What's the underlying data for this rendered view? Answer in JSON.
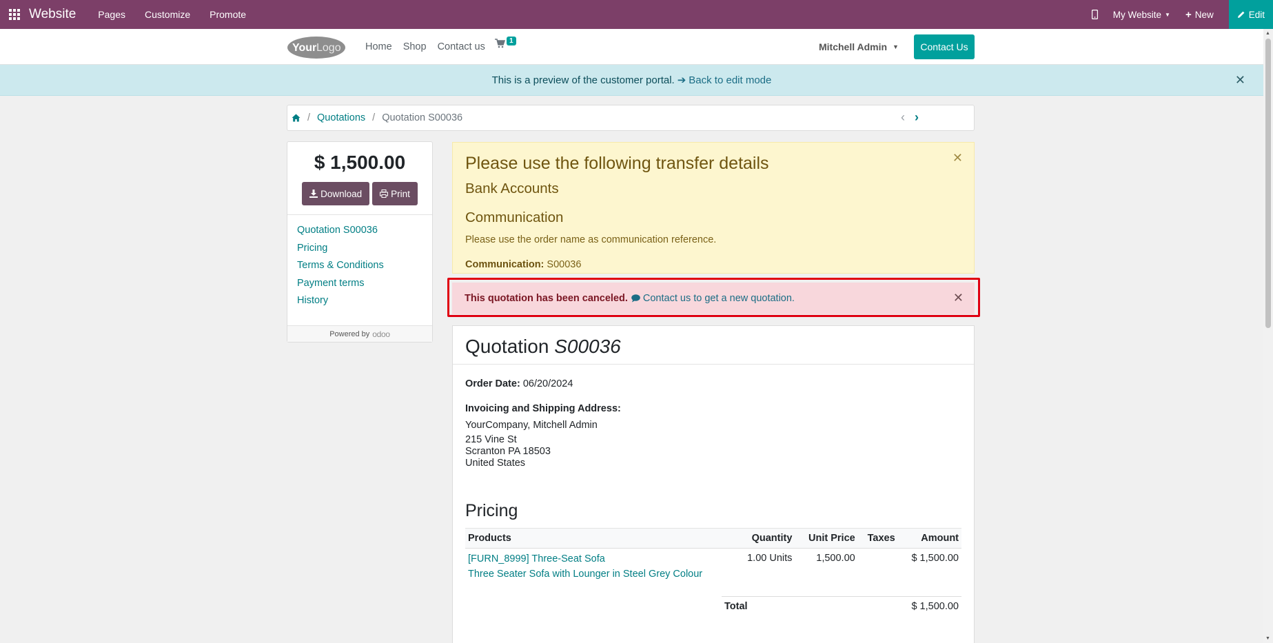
{
  "adminbar": {
    "brand": "Website",
    "menu": [
      "Pages",
      "Customize",
      "Promote"
    ],
    "my_website": "My Website",
    "new_label": "New",
    "edit_label": "Edit"
  },
  "header": {
    "logo_text_a": "Your",
    "logo_text_b": "Logo",
    "nav": [
      "Home",
      "Shop",
      "Contact us"
    ],
    "cart_count": "1",
    "user_name": "Mitchell Admin",
    "contact_button": "Contact Us"
  },
  "preview_banner": {
    "text": "This is a preview of the customer portal.",
    "link": "Back to edit mode"
  },
  "breadcrumb": {
    "items": [
      "Quotations",
      "Quotation S00036"
    ]
  },
  "sidebar": {
    "amount": "$ 1,500.00",
    "download_label": "Download",
    "print_label": "Print",
    "toc": [
      "Quotation S00036",
      "Pricing",
      "Terms & Conditions",
      "Payment terms",
      "History"
    ],
    "powered_by": "Powered by",
    "odoo_word": "odoo"
  },
  "transfer_alert": {
    "title": "Please use the following transfer details",
    "bank_accounts": "Bank Accounts",
    "communication_heading": "Communication",
    "instruction": "Please use the order name as communication reference.",
    "communication_label": "Communication:",
    "communication_value": "S00036"
  },
  "canceled_alert": {
    "text": "This quotation has been canceled.",
    "link": "Contact us to get a new quotation."
  },
  "quotation": {
    "title_prefix": "Quotation",
    "number": "S00036",
    "order_date_label": "Order Date:",
    "order_date": "06/20/2024",
    "address_label": "Invoicing and Shipping Address:",
    "address_lines": [
      "YourCompany, Mitchell Admin",
      "215 Vine St",
      "Scranton PA 18503",
      "United States"
    ],
    "pricing_heading": "Pricing",
    "columns": [
      "Products",
      "Quantity",
      "Unit Price",
      "Taxes",
      "Amount"
    ],
    "lines": [
      {
        "product": "[FURN_8999] Three-Seat Sofa",
        "description": "Three Seater Sofa with Lounger in Steel Grey Colour",
        "quantity": "1.00 Units",
        "unit_price": "1,500.00",
        "taxes": "",
        "amount": "$ 1,500.00"
      }
    ],
    "total_label": "Total",
    "total_value": "$ 1,500.00"
  },
  "colors": {
    "admin_bar": "#7c3f68",
    "accent": "#01a09d",
    "warning_bg": "#fdf6cf",
    "danger_bg": "#f8d7dc",
    "highlight_outline": "#e00012"
  }
}
